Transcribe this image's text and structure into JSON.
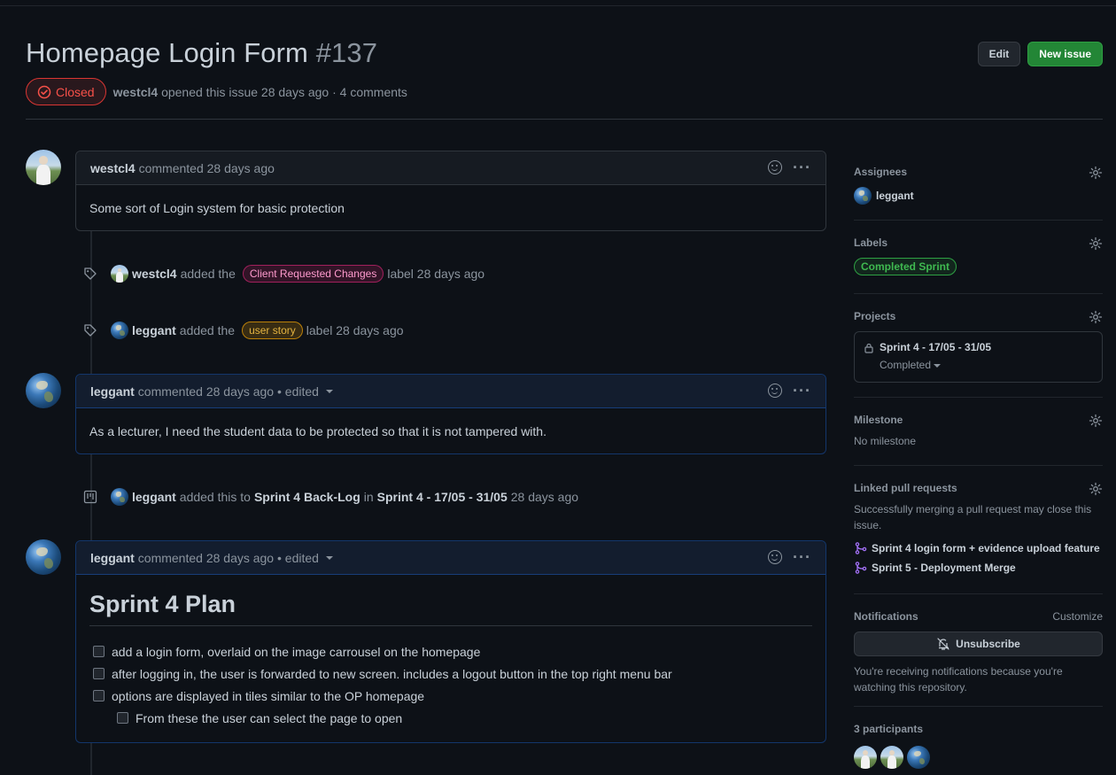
{
  "issue": {
    "title": "Homepage Login Form",
    "number": "#137",
    "status": "Closed",
    "author": "westcl4",
    "meta_text": "opened this issue 28 days ago · 4 comments"
  },
  "header_buttons": {
    "edit": "Edit",
    "new_issue": "New issue"
  },
  "timeline": {
    "c1": {
      "author": "westcl4",
      "action": "commented 28 days ago",
      "body": "Some sort of Login system for basic protection"
    },
    "e1": {
      "author": "westcl4",
      "pre": "added the",
      "label": "Client Requested Changes",
      "post": "label 28 days ago"
    },
    "e2": {
      "author": "leggant",
      "pre": "added the",
      "label": "user story",
      "post": "label 28 days ago"
    },
    "c2": {
      "author": "leggant",
      "action": "commented 28 days ago • edited",
      "body": "As a lecturer, I need the student data to be protected so that it is not tampered with."
    },
    "e3": {
      "author": "leggant",
      "pre": "added this to",
      "column": "Sprint 4 Back-Log",
      "in": "in",
      "project": "Sprint 4 - 17/05 - 31/05",
      "time": "28 days ago"
    },
    "c3": {
      "author": "leggant",
      "action": "commented 28 days ago • edited",
      "heading": "Sprint 4 Plan",
      "tasks": [
        "add a login form, overlaid on the image carrousel on the homepage",
        "after logging in, the user is forwarded to new screen. includes a logout button in the top right menu bar",
        "options are displayed in tiles similar to the OP homepage",
        "From these the user can select the page to open"
      ]
    }
  },
  "sidebar": {
    "assignees": {
      "title": "Assignees",
      "user": "leggant"
    },
    "labels": {
      "title": "Labels",
      "label": "Completed Sprint"
    },
    "projects": {
      "title": "Projects",
      "name": "Sprint 4 - 17/05 - 31/05",
      "status": "Completed"
    },
    "milestone": {
      "title": "Milestone",
      "value": "No milestone"
    },
    "linked": {
      "title": "Linked pull requests",
      "desc": "Successfully merging a pull request may close this issue.",
      "prs": [
        "Sprint 4 login form + evidence upload feature",
        "Sprint 5 - Deployment Merge"
      ]
    },
    "notifications": {
      "title": "Notifications",
      "customize": "Customize",
      "button": "Unsubscribe",
      "desc": "You're receiving notifications because you're watching this repository."
    },
    "participants": {
      "title": "3 participants"
    }
  },
  "colors": {
    "closed": "#f85149",
    "green_button": "#238636",
    "label_pink": "#ff9bce",
    "label_yellow": "#e3b341",
    "label_green": "#3fb950",
    "pr_icon": "#a371f7"
  }
}
